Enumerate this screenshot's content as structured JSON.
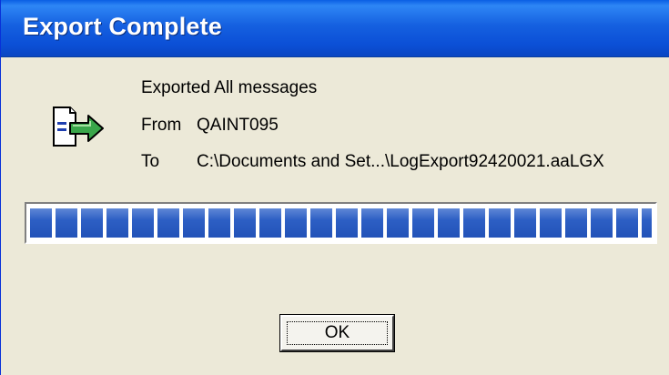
{
  "window": {
    "title": "Export Complete"
  },
  "icon": {
    "name": "export-document-arrow-icon"
  },
  "message": {
    "heading": "Exported All messages",
    "from_label": "From",
    "from_value": "QAINT095",
    "to_label": "To",
    "to_value": "C:\\Documents and Set...\\LogExport92420021.aaLGX"
  },
  "progress": {
    "fraction": 1.0,
    "segments": 27,
    "color": "#2d5fc4"
  },
  "buttons": {
    "ok_label": "OK"
  },
  "colors": {
    "titlebar": "#0b4fd6",
    "dialog_bg": "#ece9d8"
  }
}
